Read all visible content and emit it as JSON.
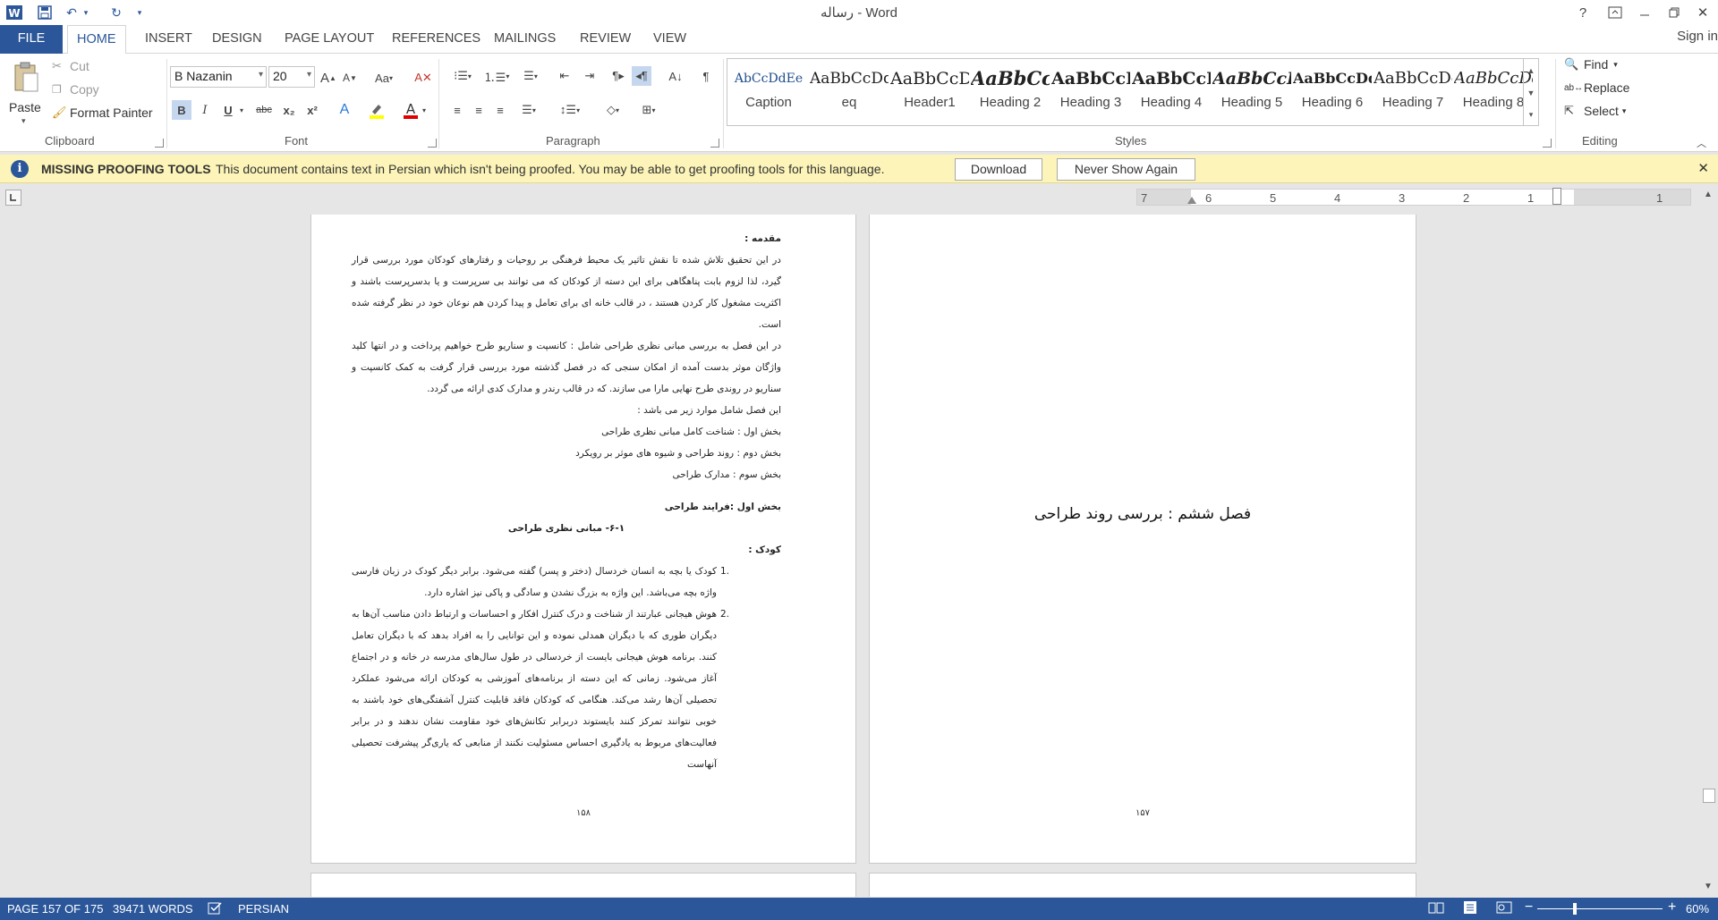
{
  "title_bar": {
    "document_name": "رساله - Word",
    "help": "?",
    "icons": [
      "word-logo",
      "save",
      "undo",
      "redo",
      "customize-qat"
    ]
  },
  "tabs": [
    "FILE",
    "HOME",
    "INSERT",
    "DESIGN",
    "PAGE LAYOUT",
    "REFERENCES",
    "MAILINGS",
    "REVIEW",
    "VIEW"
  ],
  "active_tab": "HOME",
  "sign_in": "Sign in",
  "clipboard": {
    "paste": "Paste",
    "cut": "Cut",
    "copy": "Copy",
    "format_painter": "Format Painter",
    "label": "Clipboard"
  },
  "font": {
    "family": "B Nazanin",
    "size": "20",
    "label": "Font",
    "bold": "B",
    "italic": "I",
    "underline": "U",
    "strike": "abc",
    "sub": "x₂",
    "sup": "x²",
    "grow": "A",
    "shrink": "A",
    "case": "Aa",
    "highlight_color": "#ffff00",
    "font_color": "#e00000"
  },
  "paragraph": {
    "label": "Paragraph"
  },
  "styles": {
    "label": "Styles",
    "items": [
      {
        "sample": "AbCcDdEe",
        "name": "Caption"
      },
      {
        "sample": "AaBbCcDdEe",
        "name": "eq"
      },
      {
        "sample": "AaBbCcDdEe",
        "name": "Header1"
      },
      {
        "sample": "AaBbCcDdEe",
        "name": "Heading 2"
      },
      {
        "sample": "AaBbCcDdEe",
        "name": "Heading 3"
      },
      {
        "sample": "AaBbCcDdEe",
        "name": "Heading 4"
      },
      {
        "sample": "AaBbCcDdEe",
        "name": "Heading 5"
      },
      {
        "sample": "AaBbCcDdEe",
        "name": "Heading 6"
      },
      {
        "sample": "AaBbCcDdEe",
        "name": "Heading 7"
      },
      {
        "sample": "AaBbCcDdEe",
        "name": "Heading 8"
      }
    ]
  },
  "editing": {
    "label": "Editing",
    "find": "Find",
    "replace": "Replace",
    "select": "Select"
  },
  "message_bar": {
    "title": "MISSING PROOFING TOOLS",
    "text": "This document contains text in Persian which isn't being proofed. You may be able to get proofing tools for this language.",
    "download": "Download",
    "never_show": "Never Show Again"
  },
  "ruler": {
    "ticks": [
      "7",
      "6",
      "5",
      "4",
      "3",
      "2",
      "1",
      "1"
    ]
  },
  "left_page": {
    "intro_heading": "مقدمه :",
    "intro_p1": "در این تحقیق تلاش شده تا نقش تاثیر یک محیط فرهنگی بر روحیات و رفتارهای کودکان مورد بررسی قرار گیرد، لذا لزوم بابت پناهگاهی برای این دسته از کودکان که می توانند بی سرپرست و یا بدسرپرست باشند و اکثریت مشغول کار کردن هستند ، در قالب خانه ای برای تعامل و پیدا کردن هم نوعان خود در نظر گرفته شده است.",
    "intro_p2": "در این فصل به بررسی مبانی نظری طراحی شامل : کانسپت و سناریو طرح خواهیم پرداخت و در انتها کلید واژگان موثر بدست آمده از امکان سنجی که در فصل گذشته مورد بررسی قرار گرفت به کمک کانسپت و سناریو در روندی طرح نهایی مارا می سازند. که در قالب رندر و مدارک کدی ارائه می گردد.",
    "intro_p3": "این فصل شامل موارد زیر می باشد :",
    "part1": "بخش اول : شناخت کامل مبانی نظری طراحی",
    "part2": "بخش دوم : روند طراحی و شیوه های موثر بر رویکرد",
    "part3": "بخش سوم : مدارک طراحی",
    "section_heading": "بخش اول :فرایند طراحی",
    "sub_heading": "۶-۱- مبانی نظری طراحی",
    "child_heading": "کودک :",
    "item1_num": "1.",
    "item1": "کودک یا بچه به انسان خردسال (دختر و پسر) گفته می‌شود. برابر دیگر کودک در زبان فارسی واژه بچه می‌باشد. این واژه به بزرگ نشدن و سادگی و پاکی نیز اشاره دارد.",
    "item2_num": "2.",
    "item2": "هوش هیجانی عبارتند از شناخت و درک کنترل افکار و احساسات و ارتباط دادن مناسب آن‌ها به دیگران طوری که با دیگران همدلی نموده و این توانایی را به افراد بدهد که با دیگران تعامل کنند. برنامه هوش هیجانی بایست از خردسالی در طول سال‌های مدرسه در خانه و در اجتماع آغاز می‌شود. زمانی که این دسته از برنامه‌های آموزشی به کودکان ارائه می‌شود عملکرد تحصیلی آن‌ها رشد می‌کند. هنگامی که کودکان فاقد قابلیت کنترل آشفتگی‌های خود باشند به خوبی نتوانند تمرکز کنند بایستوند دربرابر تکانش‌های خود مقاومت نشان ندهند و در برابر فعالیت‌های مربوط به یادگیری احساس مسئولیت نکنند از منابعی که یاری‌گر پیشرفت تحصیلی آنهاست",
    "page_number": "۱۵۸"
  },
  "right_page": {
    "chapter_title": "فصل ششم : بررسی روند طراحی",
    "page_number": "۱۵۷"
  },
  "status_bar": {
    "page": "PAGE 157 OF 175",
    "words": "39471 WORDS",
    "language": "PERSIAN",
    "zoom": "60%",
    "zoom_minus": "−",
    "zoom_plus": "+"
  }
}
